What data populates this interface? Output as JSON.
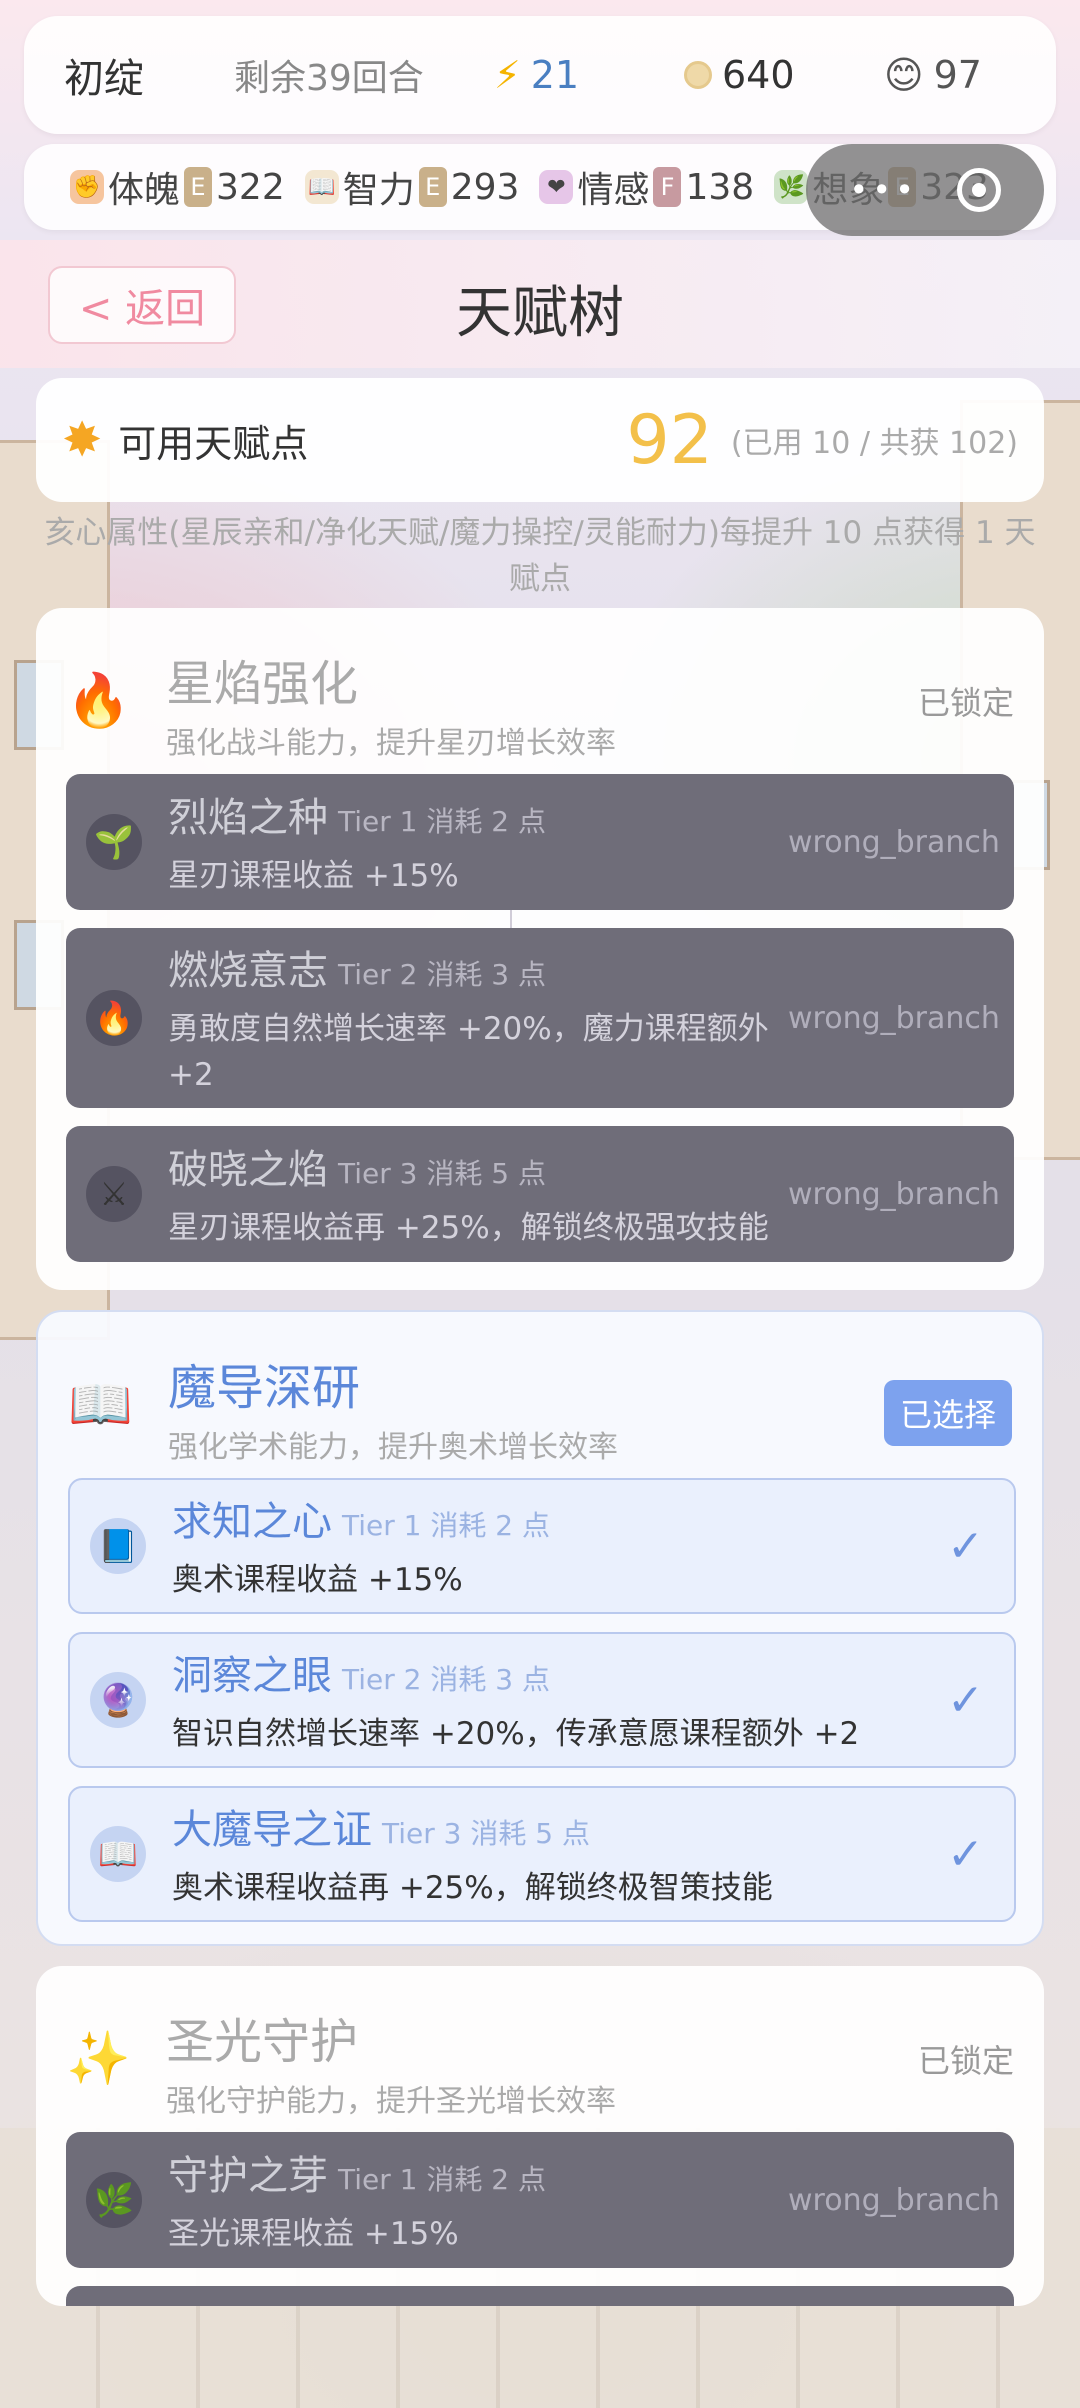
{
  "status_bar": {
    "stage": "初绽",
    "turns_left": "剩余39回合",
    "energy": "21",
    "coins": "640",
    "mood": "97",
    "energy_icon": "lightning-icon",
    "coin_icon": "coin-icon",
    "mood_icon": "smile-icon"
  },
  "attributes": [
    {
      "name": "体魄",
      "grade": "E",
      "value": "322",
      "icon": "fist-icon"
    },
    {
      "name": "智力",
      "grade": "E",
      "value": "293",
      "icon": "book-icon"
    },
    {
      "name": "情感",
      "grade": "F",
      "value": "138",
      "icon": "heart-icon"
    },
    {
      "name": "想象",
      "grade": "E",
      "value": "323",
      "icon": "leaf-icon"
    }
  ],
  "capsule": {
    "more_label": "•••"
  },
  "header": {
    "back_label": "< 返回",
    "title": "天赋树"
  },
  "talent_points": {
    "label": "可用天赋点",
    "available": "92",
    "detail": "(已用 10 / 共获 102)"
  },
  "hint": "亥心属性(星辰亲和/净化天赋/魔力操控/灵能耐力)每提升 10 点获得 1 天赋点",
  "branches": [
    {
      "name": "星焰强化",
      "desc": "强化战斗能力，提升星刃增长效率",
      "status": "已锁定",
      "icon": "fire-icon",
      "nodes": [
        {
          "name": "烈焰之种",
          "meta": "Tier 1 消耗 2 点",
          "effect": "星刃课程收益 +15%",
          "state": "wrong_branch",
          "icon": "sprout-icon"
        },
        {
          "name": "燃烧意志",
          "meta": "Tier 2 消耗 3 点",
          "effect": "勇敢度自然增长速率 +20%，魔力课程额外 +2",
          "state": "wrong_branch",
          "icon": "fire-icon"
        },
        {
          "name": "破晓之焰",
          "meta": "Tier 3 消耗 5 点",
          "effect": "星刃课程收益再 +25%，解锁终极强攻技能",
          "state": "wrong_branch",
          "icon": "crossed-swords-icon"
        }
      ]
    },
    {
      "name": "魔导深研",
      "desc": "强化学术能力，提升奥术增长效率",
      "status": "已选择",
      "icon": "open-book-icon",
      "nodes": [
        {
          "name": "求知之心",
          "meta": "Tier 1 消耗 2 点",
          "effect": "奥术课程收益 +15%",
          "state": "done",
          "icon": "blue-book-icon"
        },
        {
          "name": "洞察之眼",
          "meta": "Tier 2 消耗 3 点",
          "effect": "智识自然增长速率 +20%，传承意愿课程额外 +2",
          "state": "done",
          "icon": "crystal-ball-icon"
        },
        {
          "name": "大魔导之证",
          "meta": "Tier 3 消耗 5 点",
          "effect": "奥术课程收益再 +25%，解锁终极智策技能",
          "state": "done",
          "icon": "open-book-icon"
        }
      ]
    },
    {
      "name": "圣光守护",
      "desc": "强化守护能力，提升圣光增长效率",
      "status": "已锁定",
      "icon": "sparkles-icon",
      "nodes": [
        {
          "name": "守护之芽",
          "meta": "Tier 1 消耗 2 点",
          "effect": "圣光课程收益 +15%",
          "state": "wrong_branch",
          "icon": "herb-icon"
        }
      ]
    }
  ]
}
